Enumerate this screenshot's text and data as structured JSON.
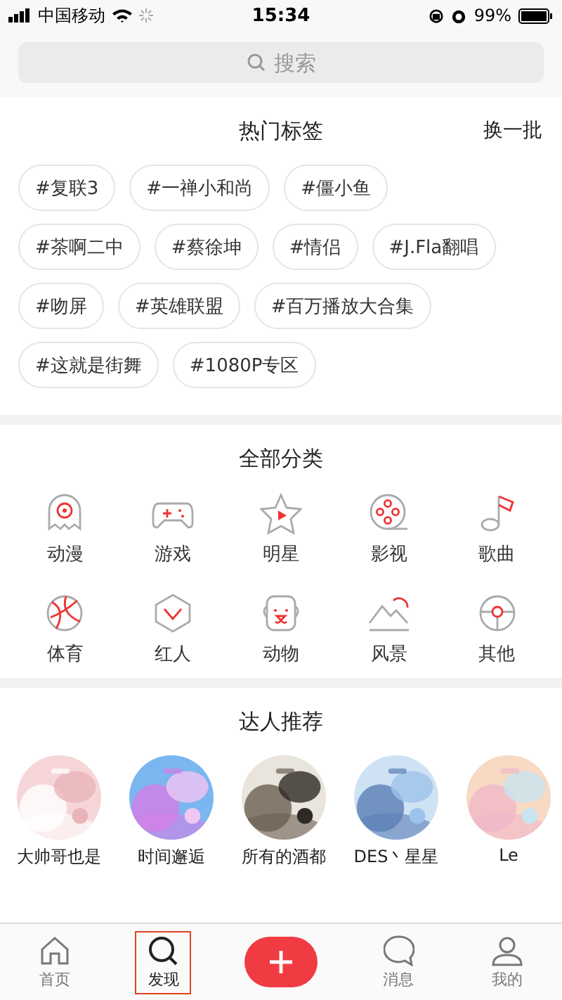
{
  "status_bar": {
    "carrier": "中国移动",
    "time": "15:34",
    "battery": "99%"
  },
  "search": {
    "placeholder": "搜索"
  },
  "hot_tags": {
    "title": "热门标签",
    "refresh": "换一批",
    "tags": [
      [
        "#复联3",
        "#一禅小和尚",
        "#僵小鱼"
      ],
      [
        "#茶啊二中",
        "#蔡徐坤",
        "#情侣",
        "#J.Fla翻唱"
      ],
      [
        "#吻屏",
        "#英雄联盟",
        "#百万播放大合集"
      ],
      [
        "#这就是街舞",
        "#1080P专区"
      ]
    ]
  },
  "categories": {
    "title": "全部分类",
    "items": [
      {
        "label": "动漫",
        "kind": "anime"
      },
      {
        "label": "游戏",
        "kind": "game"
      },
      {
        "label": "明星",
        "kind": "star"
      },
      {
        "label": "影视",
        "kind": "film"
      },
      {
        "label": "歌曲",
        "kind": "music"
      },
      {
        "label": "体育",
        "kind": "sport"
      },
      {
        "label": "红人",
        "kind": "celebrity"
      },
      {
        "label": "动物",
        "kind": "animal"
      },
      {
        "label": "风景",
        "kind": "scenery"
      },
      {
        "label": "其他",
        "kind": "other"
      }
    ]
  },
  "recommend": {
    "title": "达人推荐",
    "users": [
      {
        "name": "大帅哥也是",
        "kind": "picture"
      },
      {
        "name": "时间邂逅",
        "kind": "picture"
      },
      {
        "name": "所有的酒都",
        "kind": "picture"
      },
      {
        "name": "DES丶星星",
        "kind": "picture"
      },
      {
        "name": "Le",
        "kind": "picture"
      }
    ]
  },
  "tab_bar": [
    {
      "label": "首页",
      "kind": "home",
      "selected": false
    },
    {
      "label": "发现",
      "kind": "discover",
      "selected": true
    },
    {
      "kind": "add"
    },
    {
      "label": "消息",
      "kind": "message",
      "selected": false
    },
    {
      "label": "我的",
      "kind": "profile",
      "selected": false
    }
  ]
}
